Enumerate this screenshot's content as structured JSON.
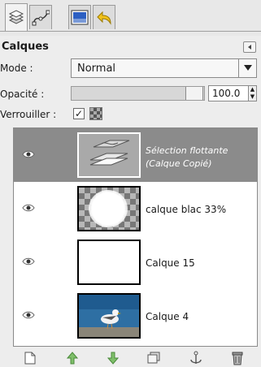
{
  "tabs": [
    {
      "icon": "layers-icon"
    },
    {
      "icon": "paths-icon"
    },
    {
      "icon": "channels-icon"
    },
    {
      "icon": "undo-icon"
    }
  ],
  "panel": {
    "title": "Calques",
    "menu_icon": "panel-menu-icon"
  },
  "mode": {
    "label": "Mode :",
    "value": "Normal"
  },
  "opacity": {
    "label": "Opacité :",
    "value": "100.0",
    "percent": 100
  },
  "lock": {
    "label": "Verrouiller :",
    "checked": true
  },
  "layers": [
    {
      "name_line1": "Sélection flottante",
      "name_line2": "(Calque Copié)",
      "selected": true,
      "visible": true
    },
    {
      "name": "calque blac 33%",
      "selected": false,
      "visible": true
    },
    {
      "name": "Calque 15",
      "selected": false,
      "visible": true
    },
    {
      "name": "Calque 4",
      "selected": false,
      "visible": true
    }
  ],
  "toolbar": [
    {
      "icon": "new-layer-icon"
    },
    {
      "icon": "raise-layer-icon"
    },
    {
      "icon": "lower-layer-icon"
    },
    {
      "icon": "duplicate-layer-icon"
    },
    {
      "icon": "anchor-layer-icon"
    },
    {
      "icon": "delete-layer-icon"
    }
  ],
  "colors": {
    "selected_row": "#8b8b8b",
    "raise_arrow": "#7fbf6a",
    "lower_arrow": "#7fbf6a"
  }
}
